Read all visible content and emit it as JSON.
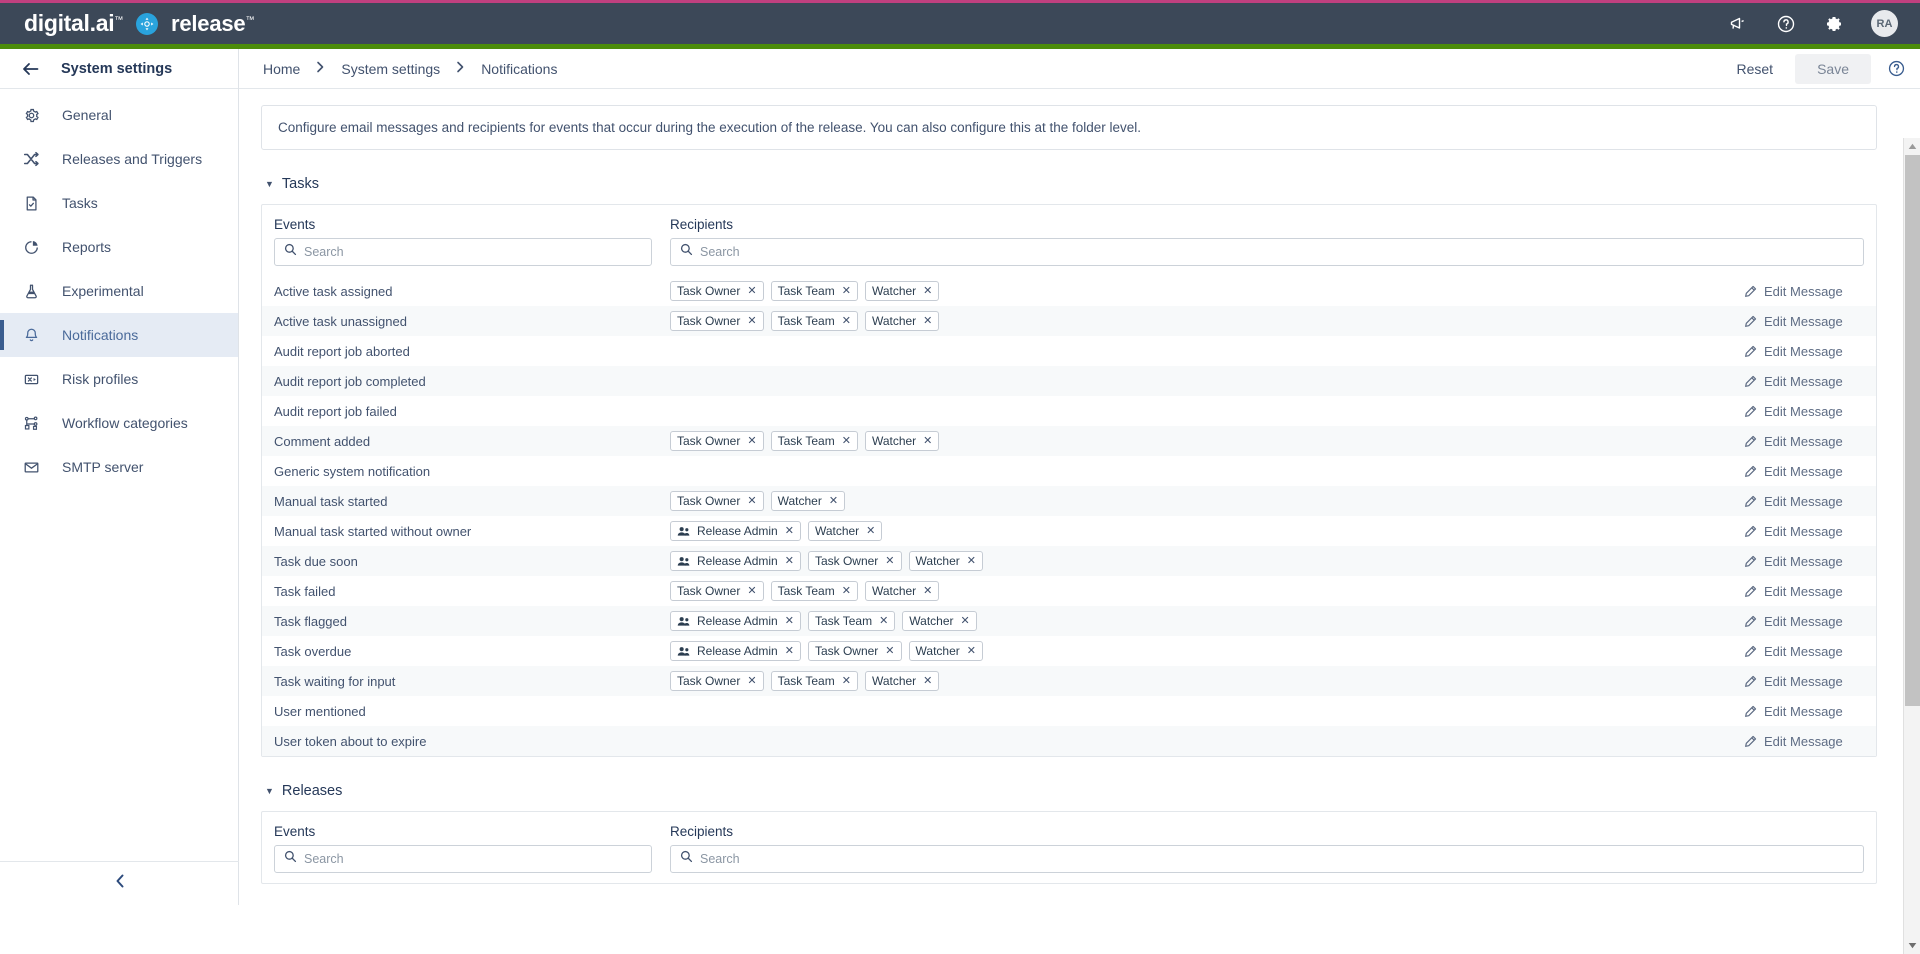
{
  "brand": {
    "digital": "digital.ai",
    "product": "release",
    "tm": "™",
    "logo_icon": "release-logo-icon"
  },
  "topbar": {
    "icons": [
      {
        "name": "announcements-icon",
        "label": "Announcements"
      },
      {
        "name": "help-circle-icon",
        "label": "Help"
      },
      {
        "name": "gear-icon",
        "label": "Settings"
      }
    ],
    "avatar_initials": "RA"
  },
  "sidebar": {
    "back_icon": "arrow-left-icon",
    "title": "System settings",
    "collapse_icon": "chevron-left-icon",
    "items": [
      {
        "label": "General",
        "icon": "gear-icon",
        "active": false
      },
      {
        "label": "Releases and Triggers",
        "icon": "shuffle-icon",
        "active": false
      },
      {
        "label": "Tasks",
        "icon": "document-check-icon",
        "active": false
      },
      {
        "label": "Reports",
        "icon": "pie-chart-icon",
        "active": false
      },
      {
        "label": "Experimental",
        "icon": "flask-icon",
        "active": false
      },
      {
        "label": "Notifications",
        "icon": "bell-icon",
        "active": true
      },
      {
        "label": "Risk profiles",
        "icon": "risk-box-icon",
        "active": false
      },
      {
        "label": "Workflow categories",
        "icon": "workflow-nodes-icon",
        "active": false
      },
      {
        "label": "SMTP server",
        "icon": "envelope-icon",
        "active": false
      }
    ]
  },
  "toolbar": {
    "breadcrumb": [
      "Home",
      "System settings",
      "Notifications"
    ],
    "separator": "›",
    "reset_label": "Reset",
    "save_label": "Save",
    "help_icon": "help-circle-icon"
  },
  "notice": "Configure email messages and recipients for events that occur during the execution of the release. You can also configure this at the folder level.",
  "sections": [
    {
      "title": "Tasks",
      "expanded": true,
      "columns": {
        "events": "Events",
        "recipients": "Recipients"
      },
      "search": {
        "events_placeholder": "Search",
        "recipients_placeholder": "Search",
        "icon": "search-icon"
      },
      "edit_label": "Edit Message",
      "edit_icon": "pencil-icon",
      "rows": [
        {
          "event": "Active task assigned",
          "recipients": [
            {
              "label": "Task Owner"
            },
            {
              "label": "Task Team"
            },
            {
              "label": "Watcher"
            }
          ]
        },
        {
          "event": "Active task unassigned",
          "recipients": [
            {
              "label": "Task Owner"
            },
            {
              "label": "Task Team"
            },
            {
              "label": "Watcher"
            }
          ]
        },
        {
          "event": "Audit report job aborted",
          "recipients": []
        },
        {
          "event": "Audit report job completed",
          "recipients": []
        },
        {
          "event": "Audit report job failed",
          "recipients": []
        },
        {
          "event": "Comment added",
          "recipients": [
            {
              "label": "Task Owner"
            },
            {
              "label": "Task Team"
            },
            {
              "label": "Watcher"
            }
          ]
        },
        {
          "event": "Generic system notification",
          "recipients": []
        },
        {
          "event": "Manual task started",
          "recipients": [
            {
              "label": "Task Owner"
            },
            {
              "label": "Watcher"
            }
          ]
        },
        {
          "event": "Manual task started without owner",
          "recipients": [
            {
              "label": "Release Admin",
              "icon": "group-icon"
            },
            {
              "label": "Watcher"
            }
          ]
        },
        {
          "event": "Task due soon",
          "recipients": [
            {
              "label": "Release Admin",
              "icon": "group-icon"
            },
            {
              "label": "Task Owner"
            },
            {
              "label": "Watcher"
            }
          ]
        },
        {
          "event": "Task failed",
          "recipients": [
            {
              "label": "Task Owner"
            },
            {
              "label": "Task Team"
            },
            {
              "label": "Watcher"
            }
          ]
        },
        {
          "event": "Task flagged",
          "recipients": [
            {
              "label": "Release Admin",
              "icon": "group-icon"
            },
            {
              "label": "Task Team"
            },
            {
              "label": "Watcher"
            }
          ]
        },
        {
          "event": "Task overdue",
          "recipients": [
            {
              "label": "Release Admin",
              "icon": "group-icon"
            },
            {
              "label": "Task Owner"
            },
            {
              "label": "Watcher"
            }
          ]
        },
        {
          "event": "Task waiting for input",
          "recipients": [
            {
              "label": "Task Owner"
            },
            {
              "label": "Task Team"
            },
            {
              "label": "Watcher"
            }
          ]
        },
        {
          "event": "User mentioned",
          "recipients": []
        },
        {
          "event": "User token about to expire",
          "recipients": []
        }
      ]
    },
    {
      "title": "Releases",
      "expanded": true,
      "columns": {
        "events": "Events",
        "recipients": "Recipients"
      },
      "search": {
        "events_placeholder": "Search",
        "recipients_placeholder": "Search",
        "icon": "search-icon"
      },
      "edit_label": "Edit Message",
      "edit_icon": "pencil-icon",
      "rows": []
    }
  ],
  "chip_remove_glyph": "✕",
  "colors": {
    "topbar": "#3c4858",
    "accent_pink": "#c0407f",
    "accent_green": "#4c8c0a",
    "logo_blue": "#29a3dd",
    "sidebar_active": "#e5ebf4",
    "sidebar_active_bar": "#3a5d8f",
    "row_alt": "#f7f9fa",
    "text": "#42526e"
  }
}
